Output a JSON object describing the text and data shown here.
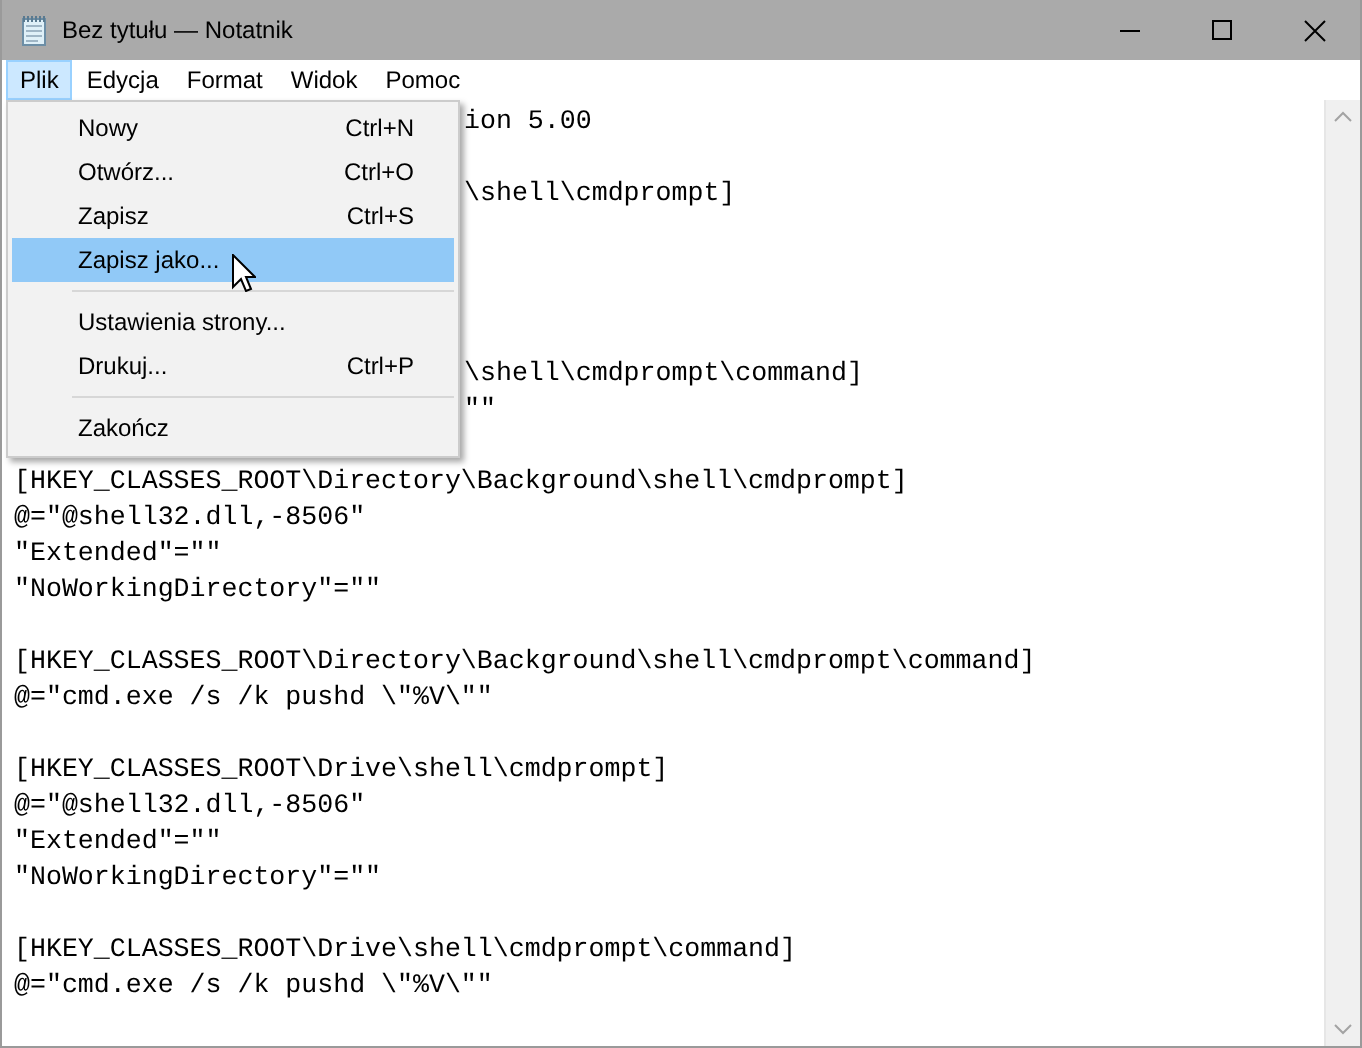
{
  "window": {
    "title": "Bez tytułu — Notatnik"
  },
  "menubar": [
    {
      "label": "Plik",
      "selected": true
    },
    {
      "label": "Edycja",
      "selected": false
    },
    {
      "label": "Format",
      "selected": false
    },
    {
      "label": "Widok",
      "selected": false
    },
    {
      "label": "Pomoc",
      "selected": false
    }
  ],
  "open_menu": {
    "items": [
      {
        "kind": "item",
        "label": "Nowy",
        "shortcut": "Ctrl+N",
        "selected": false
      },
      {
        "kind": "item",
        "label": "Otwórz...",
        "shortcut": "Ctrl+O",
        "selected": false
      },
      {
        "kind": "item",
        "label": "Zapisz",
        "shortcut": "Ctrl+S",
        "selected": false
      },
      {
        "kind": "item",
        "label": "Zapisz jako...",
        "selected": true
      },
      {
        "kind": "separator"
      },
      {
        "kind": "item",
        "label": "Ustawienia strony...",
        "selected": false
      },
      {
        "kind": "item",
        "label": "Drukuj...",
        "shortcut": "Ctrl+P",
        "selected": false
      },
      {
        "kind": "separator"
      },
      {
        "kind": "item",
        "label": "Zakończ",
        "selected": false
      }
    ]
  },
  "editor": {
    "lines": [
      {
        "kind": "covered",
        "text": "ion 5.00"
      },
      {
        "kind": "blank"
      },
      {
        "kind": "covered",
        "text": "\\shell\\cmdprompt]"
      },
      {
        "kind": "blank"
      },
      {
        "kind": "blank"
      },
      {
        "kind": "blank"
      },
      {
        "kind": "blank"
      },
      {
        "kind": "covered",
        "text": "\\shell\\cmdprompt\\command]"
      },
      {
        "kind": "covered",
        "text": "\"\""
      },
      {
        "kind": "blank"
      },
      {
        "kind": "text",
        "text": "[HKEY_CLASSES_ROOT\\Directory\\Background\\shell\\cmdprompt]"
      },
      {
        "kind": "text",
        "text": "@=\"@shell32.dll,-8506\""
      },
      {
        "kind": "text",
        "text": "\"Extended\"=\"\""
      },
      {
        "kind": "text",
        "text": "\"NoWorkingDirectory\"=\"\""
      },
      {
        "kind": "blank"
      },
      {
        "kind": "text",
        "text": "[HKEY_CLASSES_ROOT\\Directory\\Background\\shell\\cmdprompt\\command]"
      },
      {
        "kind": "text",
        "text": "@=\"cmd.exe /s /k pushd \\\"%V\\\"\""
      },
      {
        "kind": "blank"
      },
      {
        "kind": "text",
        "text": "[HKEY_CLASSES_ROOT\\Drive\\shell\\cmdprompt]"
      },
      {
        "kind": "text",
        "text": "@=\"@shell32.dll,-8506\""
      },
      {
        "kind": "text",
        "text": "\"Extended\"=\"\""
      },
      {
        "kind": "text",
        "text": "\"NoWorkingDirectory\"=\"\""
      },
      {
        "kind": "blank"
      },
      {
        "kind": "text",
        "text": "[HKEY_CLASSES_ROOT\\Drive\\shell\\cmdprompt\\command]"
      },
      {
        "kind": "text",
        "text": "@=\"cmd.exe /s /k pushd \\\"%V\\\"\""
      }
    ]
  }
}
